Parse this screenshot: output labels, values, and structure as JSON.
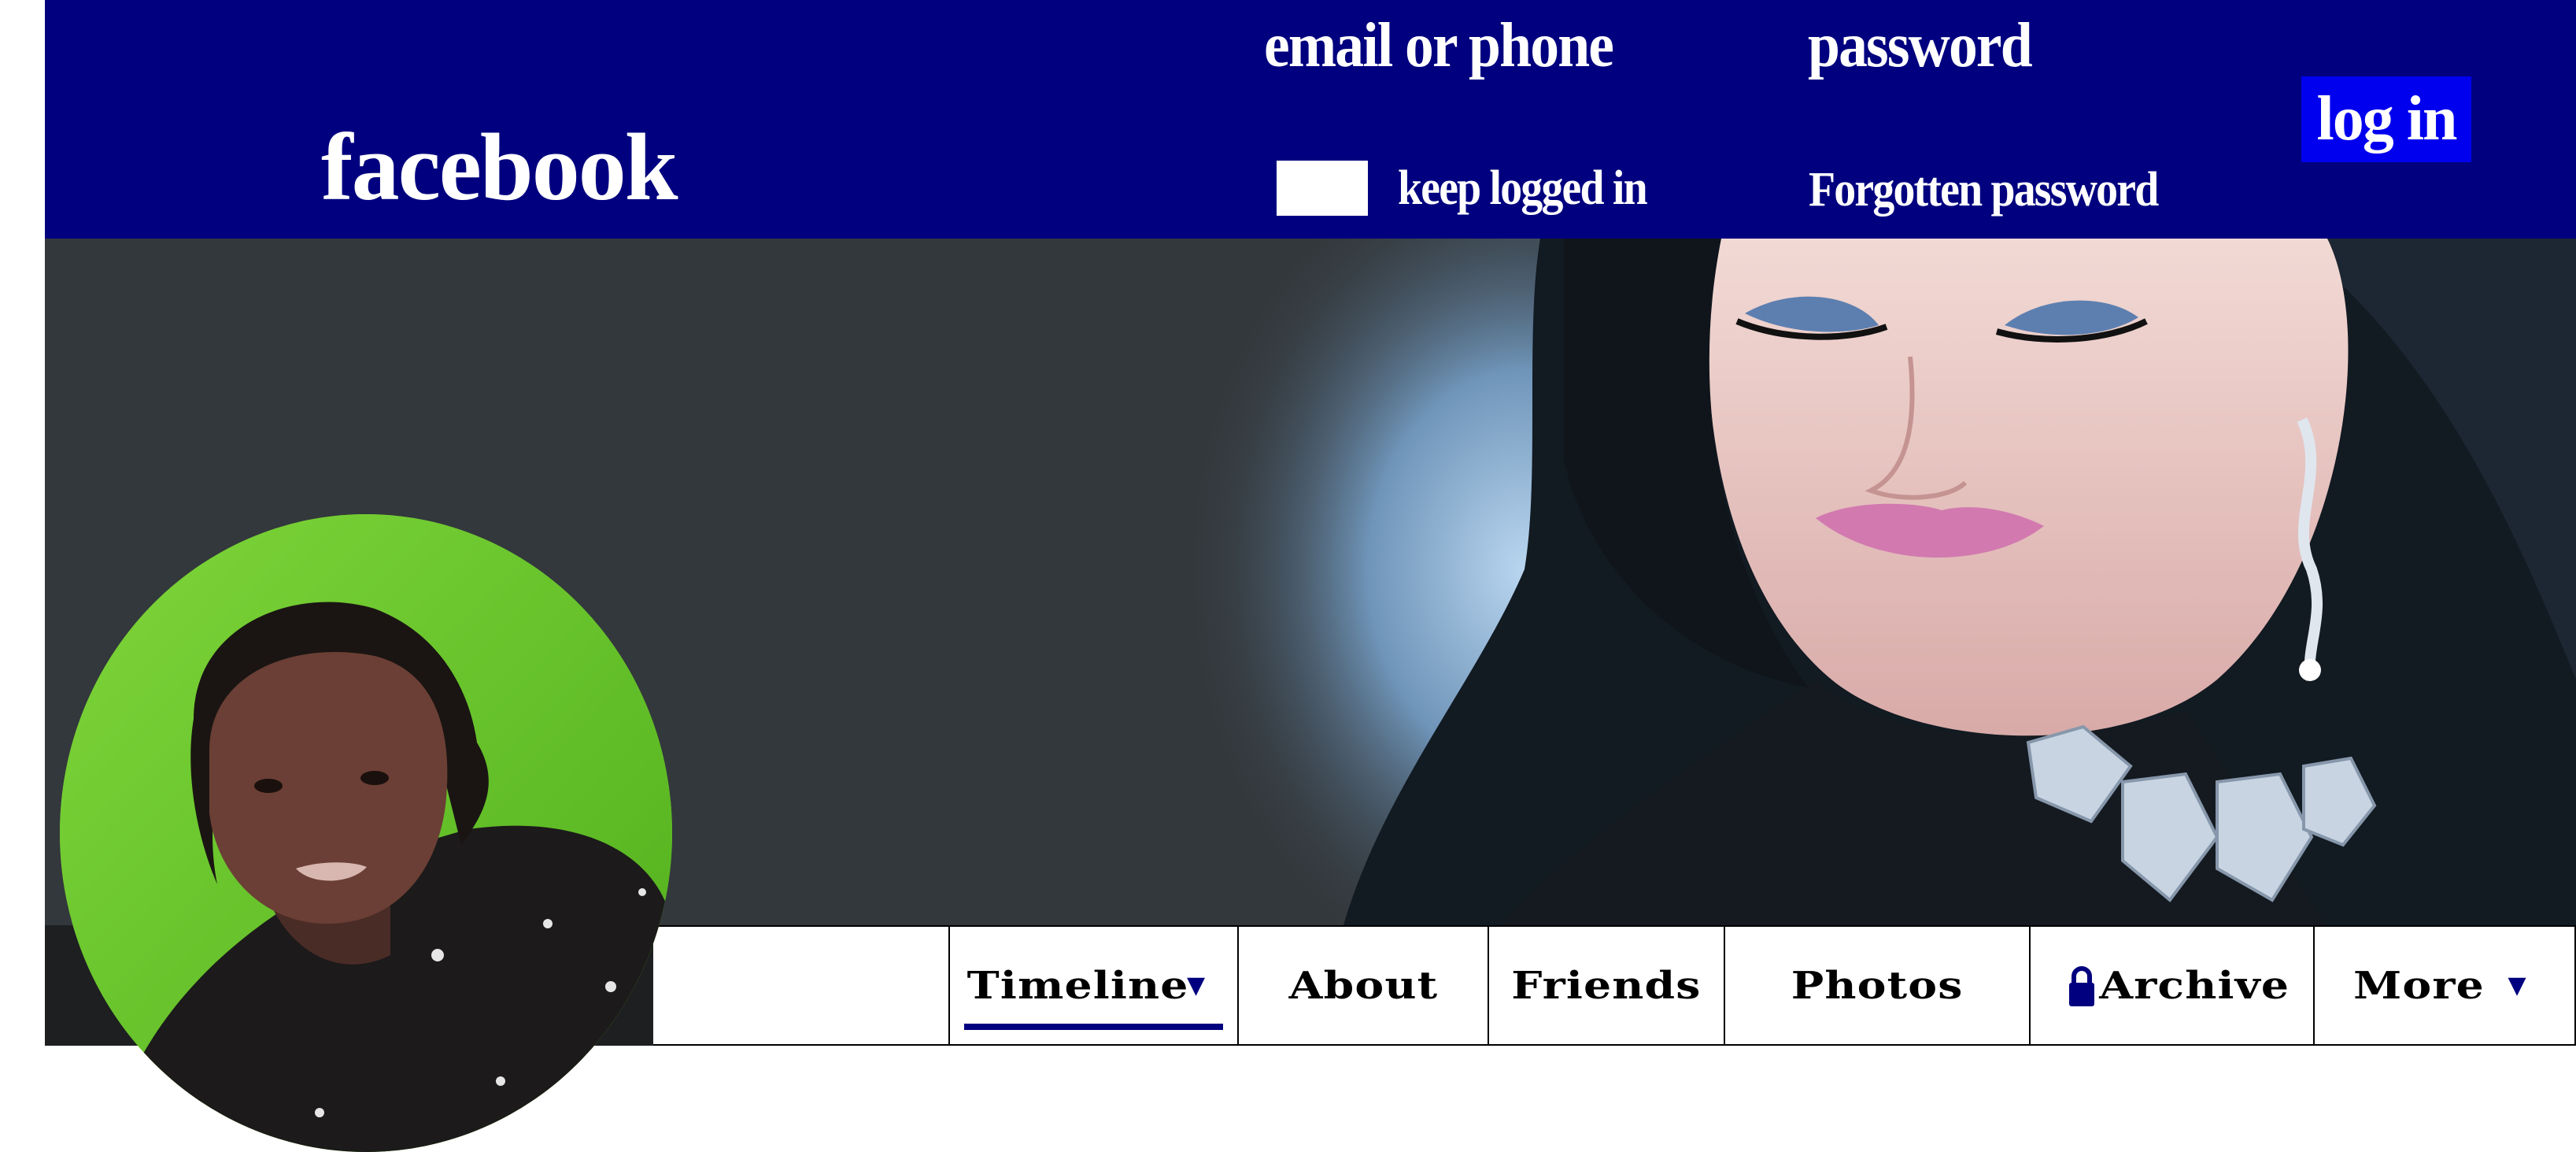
{
  "header": {
    "logo": "facebook",
    "email_label": "email or phone",
    "password_label": "password",
    "keep_logged_in_label": "keep logged in",
    "forgotten_password_label": "Forgotten password",
    "login_label": "log in",
    "colors": {
      "header_bg": "#01017f",
      "login_bg": "#0000ee"
    }
  },
  "nav": {
    "tabs": [
      {
        "label": "Timeline",
        "icon": "caret-down-icon",
        "active": true
      },
      {
        "label": "About"
      },
      {
        "label": "Friends"
      },
      {
        "label": "Photos"
      },
      {
        "label": "Archive",
        "icon": "lock-icon"
      },
      {
        "label": "More",
        "icon": "caret-down-icon"
      }
    ]
  }
}
